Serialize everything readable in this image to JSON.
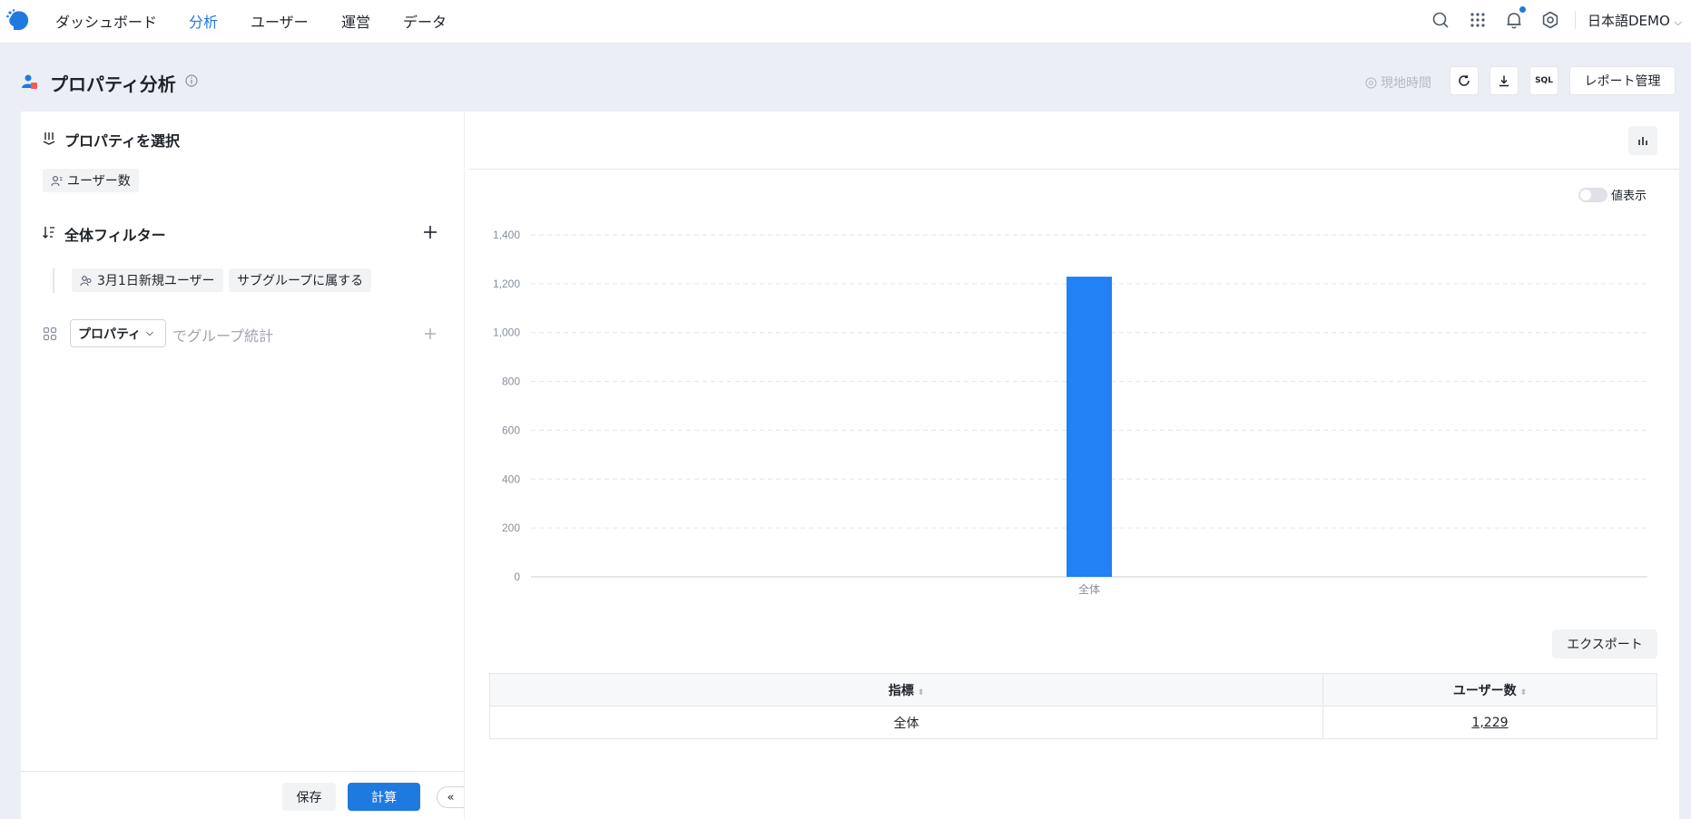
{
  "nav": {
    "items": [
      "ダッシュボード",
      "分析",
      "ユーザー",
      "運営",
      "データ"
    ],
    "active_index": 1,
    "user": "日本語DEMO"
  },
  "header": {
    "title": "プロパティ分析",
    "timezone_label": "現地時間",
    "sql_label": "SQL",
    "report_button": "レポート管理"
  },
  "left": {
    "select_title": "プロパティを選択",
    "metric_tag": "ユーザー数",
    "filter_title": "全体フィルター",
    "filter_tags": [
      "3月1日新規ユーザー",
      "サブグループに属する"
    ],
    "property_select": "プロパティ",
    "group_by_text": "でグループ統計",
    "save_button": "保存",
    "calc_button": "計算"
  },
  "right": {
    "toggle_label": "値表示",
    "export_button": "エクスポート",
    "table": {
      "headers": [
        "指標",
        "ユーザー数"
      ],
      "rows": [
        [
          "全体",
          "1,229"
        ]
      ]
    }
  },
  "colors": {
    "accent": "#1f7ae0",
    "bar": "#2181f5"
  },
  "chart_data": {
    "type": "bar",
    "categories": [
      "全体"
    ],
    "values": [
      1229
    ],
    "ylim": [
      0,
      1400
    ],
    "yticks": [
      0,
      200,
      400,
      600,
      800,
      1000,
      1200,
      1400
    ],
    "ytick_labels": [
      "0",
      "200",
      "400",
      "600",
      "800",
      "1,000",
      "1,200",
      "1,400"
    ],
    "grid": true
  }
}
